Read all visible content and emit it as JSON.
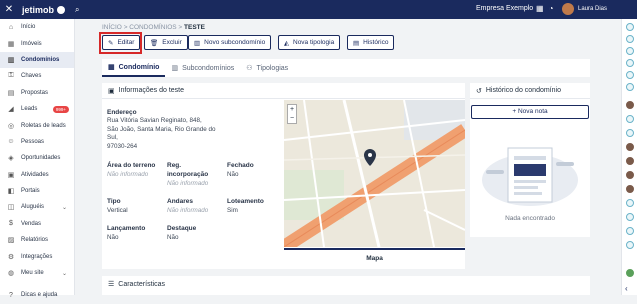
{
  "topbar": {
    "logo": "jetimob",
    "company": "Empresa Exemplo",
    "user": "Laura Dias"
  },
  "sidebar": {
    "items": [
      {
        "label": "Início",
        "icon": "home-icon",
        "glyph": "⌂"
      },
      {
        "label": "Imóveis",
        "icon": "building-icon",
        "glyph": "▦"
      },
      {
        "label": "Condomínios",
        "icon": "condo-icon",
        "glyph": "▥",
        "active": true
      },
      {
        "label": "Chaves",
        "icon": "key-icon",
        "glyph": "⚿"
      },
      {
        "label": "Propostas",
        "icon": "document-icon",
        "glyph": "▤"
      },
      {
        "label": "Leads",
        "icon": "megaphone-icon",
        "glyph": "◢",
        "badge": "999+"
      },
      {
        "label": "Roletas de leads",
        "icon": "roulette-icon",
        "glyph": "◎"
      },
      {
        "label": "Pessoas",
        "icon": "people-icon",
        "glyph": "☺"
      },
      {
        "label": "Oportunidades",
        "icon": "opportunity-icon",
        "glyph": "◈"
      },
      {
        "label": "Atividades",
        "icon": "calendar-icon",
        "glyph": "▣"
      },
      {
        "label": "Portais",
        "icon": "portal-icon",
        "glyph": "◧"
      },
      {
        "label": "Aluguéis",
        "icon": "rent-icon",
        "glyph": "◫",
        "chevron": true
      },
      {
        "label": "Vendas",
        "icon": "sales-icon",
        "glyph": "$"
      },
      {
        "label": "Relatórios",
        "icon": "chart-icon",
        "glyph": "▨"
      },
      {
        "label": "Integrações",
        "icon": "plug-icon",
        "glyph": "⚙"
      },
      {
        "label": "Meu site",
        "icon": "globe-icon",
        "glyph": "◍",
        "chevron": true
      },
      {
        "label": "Dicas e ajuda",
        "icon": "help-icon",
        "glyph": "?"
      }
    ]
  },
  "breadcrumb": {
    "home": "INÍCIO",
    "sep": ">",
    "section": "CONDOMÍNIOS",
    "current": "TESTE"
  },
  "actions": {
    "edit": "Editar",
    "delete": "Excluir",
    "new_sub": "Novo subcondomínio",
    "new_type": "Nova tipologia",
    "history": "Histórico"
  },
  "tabs": {
    "condo": "Condomínio",
    "subs": "Subcondomínios",
    "types": "Tipologias"
  },
  "info": {
    "title": "Informações do teste",
    "address_label": "Endereço",
    "address_lines": [
      "Rua Vitória Savian Reginato, 848,",
      "São João, Santa Maria, Rio Grande do",
      "Sul,",
      "97030-264"
    ],
    "area_label": "Área do terreno",
    "area_value": "Não informado",
    "reg_label_1": "Reg.",
    "reg_label_2": "incorporação",
    "reg_value": "Não informado",
    "closed_label": "Fechado",
    "closed_value": "Não",
    "type_label": "Tipo",
    "type_value": "Vertical",
    "floors_label": "Andares",
    "floors_value": "Não informado",
    "lot_label": "Loteamento",
    "lot_value": "Sim",
    "launch_label": "Lançamento",
    "launch_value": "Não",
    "highlight_label": "Destaque",
    "highlight_value": "Não"
  },
  "map": {
    "tab": "Mapa",
    "zoom_in": "+",
    "zoom_out": "−"
  },
  "history": {
    "title": "Histórico do condomínio",
    "new_note": "Nova nota",
    "empty": "Nada encontrado"
  },
  "features": {
    "title": "Características"
  }
}
